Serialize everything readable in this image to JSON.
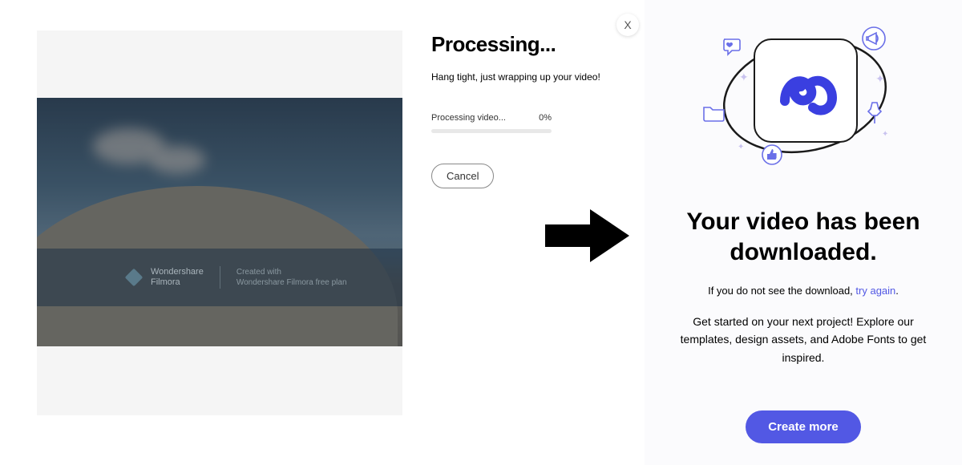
{
  "processing": {
    "title": "Processing...",
    "subtitle": "Hang tight, just wrapping up your video!",
    "status_label": "Processing video...",
    "percent": "0%",
    "cancel_label": "Cancel"
  },
  "close_label": "X",
  "watermark": {
    "brand_line1": "Wondershare",
    "brand_line2": "Filmora",
    "caption_line1": "Created with",
    "caption_line2": "Wondershare Filmora free plan"
  },
  "downloaded": {
    "title": "Your video has been downloaded.",
    "note_prefix": "If you do not see the download, ",
    "note_link": "try again",
    "note_suffix": ".",
    "description": "Get started on your next project! Explore our templates, design assets, and Adobe Fonts to get inspired.",
    "cta_label": "Create more"
  },
  "colors": {
    "accent": "#5258e4"
  }
}
